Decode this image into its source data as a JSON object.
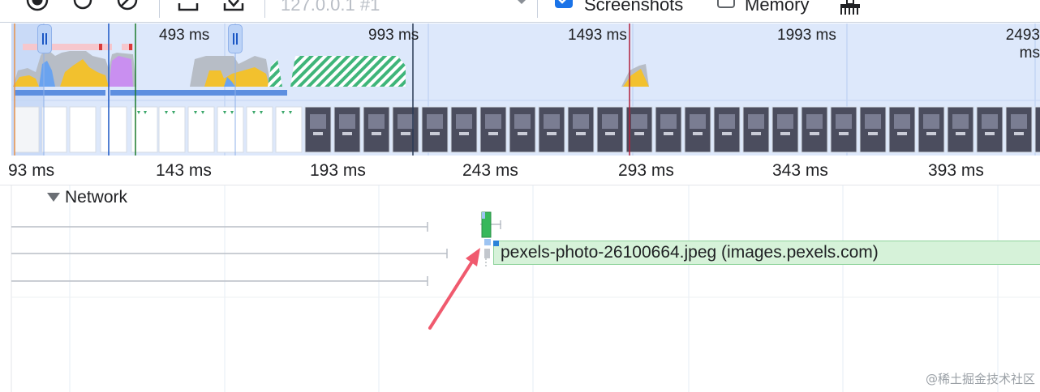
{
  "toolbar": {
    "url": "127.0.0.1 #1",
    "screenshots": {
      "label": "Screenshots",
      "checked": true
    },
    "memory": {
      "label": "Memory",
      "checked": false
    },
    "icons": [
      "record-icon",
      "reload-icon",
      "clear-icon",
      "upload-icon",
      "download-icon",
      "dropdown-icon",
      "broom-icon"
    ]
  },
  "overview": {
    "ticks": [
      "493 ms",
      "993 ms",
      "1493 ms",
      "1993 ms",
      "2493 ms"
    ]
  },
  "ruler": {
    "ticks": [
      "93 ms",
      "143 ms",
      "193 ms",
      "243 ms",
      "293 ms",
      "343 ms",
      "393 ms"
    ]
  },
  "network": {
    "title": "Network",
    "request_label": "pexels-photo-26100664.jpeg (images.pexels.com)"
  },
  "watermark": "@稀土掘金技术社区",
  "colors": {
    "accent": "#1a73e8",
    "overview_bg": "#dde8fb",
    "request_bar": "#d6f2d9",
    "arrow": "#f05a6e"
  }
}
